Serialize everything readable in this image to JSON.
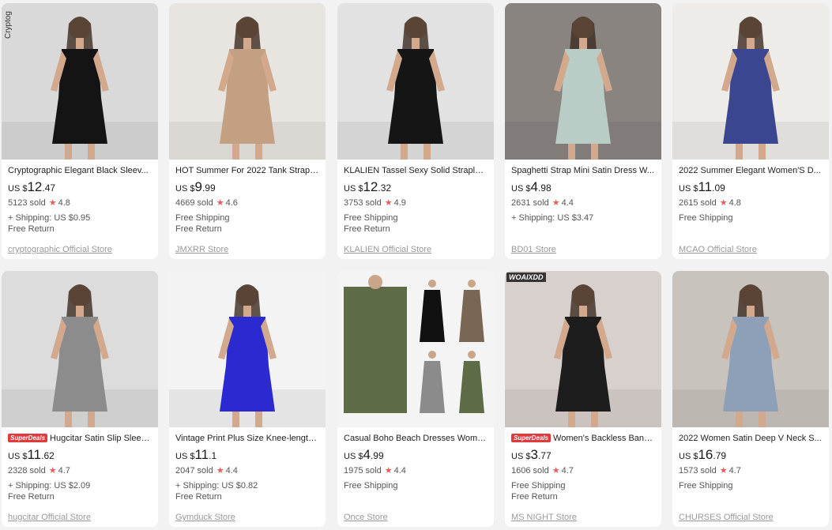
{
  "products": [
    {
      "title": "Cryptographic Elegant Black Sleev...",
      "badge": "",
      "currency": "US $",
      "price_int": "12",
      "price_dec": ".47",
      "sold": "5123 sold",
      "rating": "4.8",
      "lines": [
        "+ Shipping: US $0.95",
        "Free Return"
      ],
      "store": "cryptographic Official Store",
      "image": {
        "overlay": "Cryptog",
        "bg": "#d9d9d9",
        "dress": "#141414"
      }
    },
    {
      "title": "HOT Summer For 2022 Tank Strap ...",
      "badge": "",
      "currency": "US $",
      "price_int": "9",
      "price_dec": ".99",
      "sold": "4669 sold",
      "rating": "4.6",
      "lines": [
        "Free Shipping",
        "Free Return"
      ],
      "store": "JMXRR Store",
      "image": {
        "overlay": "",
        "bg": "#e8e4df",
        "dress": "#c4a083"
      }
    },
    {
      "title": "KLALIEN Tassel Sexy Solid Straples...",
      "badge": "",
      "currency": "US $",
      "price_int": "12",
      "price_dec": ".32",
      "sold": "3753 sold",
      "rating": "4.9",
      "lines": [
        "Free Shipping",
        "Free Return"
      ],
      "store": "KLALIEN Official Store",
      "image": {
        "overlay": "",
        "bg": "#e2e2e2",
        "dress": "#151515"
      }
    },
    {
      "title": "Spaghetti Strap Mini Satin Dress W...",
      "badge": "",
      "currency": "US $",
      "price_int": "4",
      "price_dec": ".98",
      "sold": "2631 sold",
      "rating": "4.4",
      "lines": [
        "+ Shipping: US $3.47"
      ],
      "store": "BD01 Store",
      "image": {
        "overlay": "",
        "bg": "#8a8481",
        "dress": "#b9cdc6"
      }
    },
    {
      "title": "2022 Summer Elegant Women'S D...",
      "badge": "",
      "currency": "US $",
      "price_int": "11",
      "price_dec": ".09",
      "sold": "2615 sold",
      "rating": "4.8",
      "lines": [
        "Free Shipping"
      ],
      "store": "MCAO Official Store",
      "image": {
        "overlay": "",
        "bg": "#eeece8",
        "dress": "#3a4790"
      }
    },
    {
      "title": "Hugcitar Satin Slip Sleev...",
      "badge": "SuperDeals",
      "currency": "US $",
      "price_int": "11",
      "price_dec": ".62",
      "sold": "2328 sold",
      "rating": "4.7",
      "lines": [
        "+ Shipping: US $2.09",
        "Free Return"
      ],
      "store": "hugcitar Official Store",
      "image": {
        "overlay": "",
        "bg": "#dcdcdc",
        "dress": "#8c8c8c"
      }
    },
    {
      "title": "Vintage Print Plus Size Knee-length...",
      "badge": "",
      "currency": "US $",
      "price_int": "11",
      "price_dec": ".1",
      "sold": "2047 sold",
      "rating": "4.4",
      "lines": [
        "+ Shipping: US $0.82",
        "Free Return"
      ],
      "store": "Gymduck Store",
      "image": {
        "overlay": "",
        "bg": "#f3f3f3",
        "dress": "#2a2ad0"
      }
    },
    {
      "title": "Casual Boho Beach Dresses Wome...",
      "badge": "",
      "currency": "US $",
      "price_int": "4",
      "price_dec": ".99",
      "sold": "1975 sold",
      "rating": "4.4",
      "lines": [
        "Free Shipping"
      ],
      "store": "Once Store",
      "image": {
        "overlay": "",
        "bg": "#f4f4f4",
        "dress": "#5d6b46"
      }
    },
    {
      "title": "Women's Backless Band...",
      "badge": "SuperDeals",
      "currency": "US $",
      "price_int": "3",
      "price_dec": ".77",
      "sold": "1606 sold",
      "rating": "4.7",
      "lines": [
        "Free Shipping",
        "Free Return"
      ],
      "store": "MS NIGHT Store",
      "image": {
        "overlay": "WOAIXDD",
        "bg": "#d8d0cc",
        "dress": "#1d1d1d"
      }
    },
    {
      "title": "2022 Women Satin Deep V Neck S...",
      "badge": "",
      "currency": "US $",
      "price_int": "16",
      "price_dec": ".79",
      "sold": "1573 sold",
      "rating": "4.7",
      "lines": [
        "Free Shipping"
      ],
      "store": "CHURSES Official Store",
      "image": {
        "overlay": "",
        "bg": "#c9c3bd",
        "dress": "#8ea0b8"
      }
    }
  ]
}
